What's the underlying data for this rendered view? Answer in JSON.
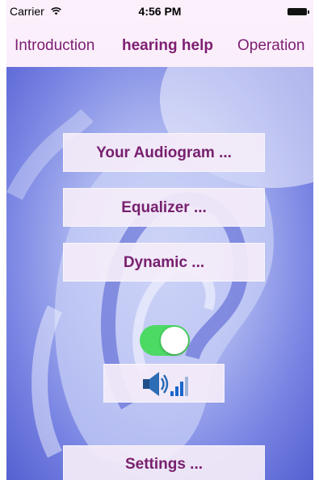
{
  "status_bar": {
    "carrier": "Carrier",
    "time": "4:56 PM"
  },
  "nav": {
    "tabs": [
      "Introduction",
      "hearing help",
      "Operation"
    ],
    "active_tab": "hearing help"
  },
  "buttons": {
    "audiogram": "Your Audiogram ...",
    "equalizer": "Equalizer ...",
    "dynamic": "Dynamic ...",
    "settings": "Settings ..."
  },
  "toggle": {
    "on": true
  },
  "icons": {
    "volume": "speaker-icon",
    "level": "signal-bars-icon",
    "wifi": "wifi-icon",
    "battery": "battery-icon"
  },
  "colors": {
    "accent": "#78206f",
    "toggle_on": "#4cd964"
  }
}
